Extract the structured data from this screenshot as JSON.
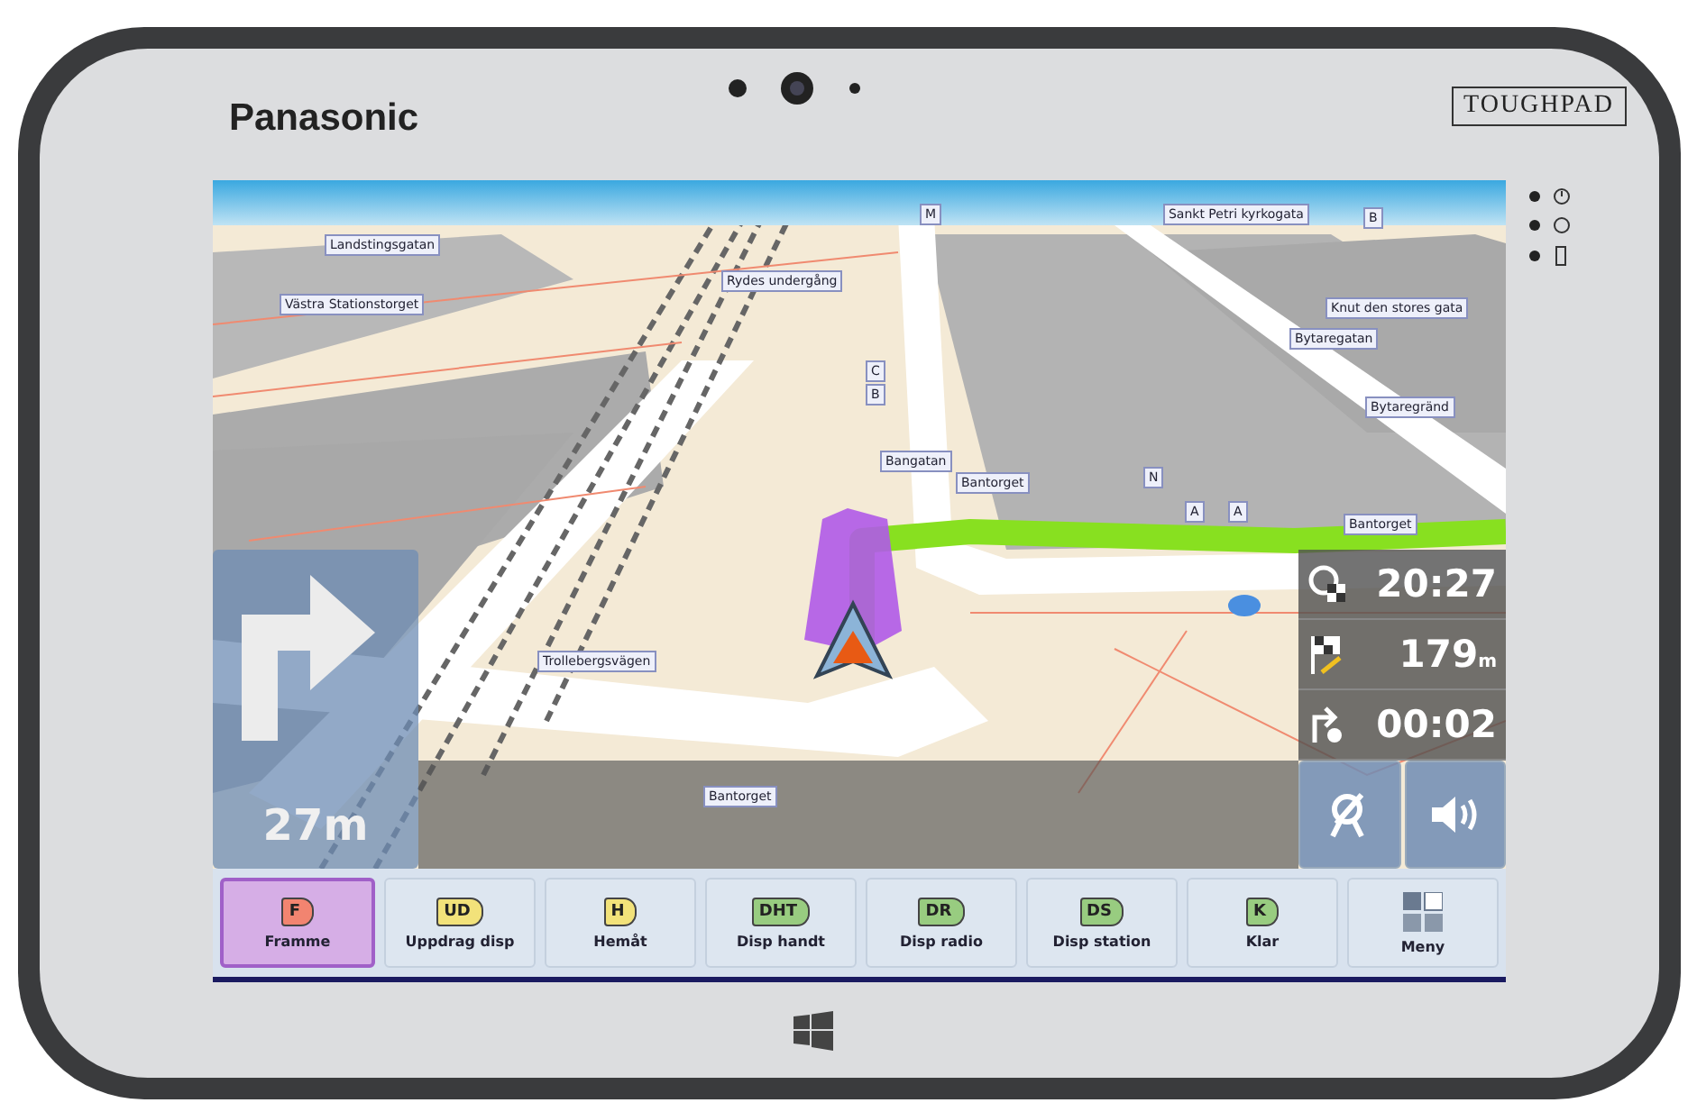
{
  "device": {
    "brand": "Panasonic",
    "model": "TOUGHPAD"
  },
  "map": {
    "street_labels": [
      {
        "text": "Landstingsgatan"
      },
      {
        "text": "Västra Stationstorget"
      },
      {
        "text": "Rydes undergång"
      },
      {
        "text": "C"
      },
      {
        "text": "B"
      },
      {
        "text": "M"
      },
      {
        "text": "Sankt Petri kyrkogata"
      },
      {
        "text": "B"
      },
      {
        "text": "Knut den stores gata"
      },
      {
        "text": "Bytaregatan"
      },
      {
        "text": "Bytaregränd"
      },
      {
        "text": "Bangatan"
      },
      {
        "text": "Bantorget"
      },
      {
        "text": "N"
      },
      {
        "text": "A"
      },
      {
        "text": "A"
      },
      {
        "text": "Bantorget"
      },
      {
        "text": "Trollebergsvägen"
      },
      {
        "text": "Bantorget"
      }
    ]
  },
  "turn": {
    "distance": "27m"
  },
  "trip": [
    {
      "kind": "arrival",
      "value": "20:27"
    },
    {
      "kind": "distance",
      "value": "179",
      "unit": "m"
    },
    {
      "kind": "time",
      "value": "00:02"
    }
  ],
  "actions": [
    {
      "kind": "tag",
      "tag": "F",
      "label": "Framme",
      "color": "#f28470",
      "selected": true
    },
    {
      "kind": "tag",
      "tag": "UD",
      "label": "Uppdrag disp",
      "color": "#f2e27a",
      "selected": false
    },
    {
      "kind": "tag",
      "tag": "H",
      "label": "Hemåt",
      "color": "#f2e27a",
      "selected": false
    },
    {
      "kind": "tag",
      "tag": "DHT",
      "label": "Disp handt",
      "color": "#98cc80",
      "selected": false
    },
    {
      "kind": "tag",
      "tag": "DR",
      "label": "Disp radio",
      "color": "#98cc80",
      "selected": false
    },
    {
      "kind": "tag",
      "tag": "DS",
      "label": "Disp station",
      "color": "#98cc80",
      "selected": false
    },
    {
      "kind": "tag",
      "tag": "K",
      "label": "Klar",
      "color": "#98cc80",
      "selected": false
    },
    {
      "kind": "menu",
      "label": "Meny",
      "selected": false
    }
  ]
}
